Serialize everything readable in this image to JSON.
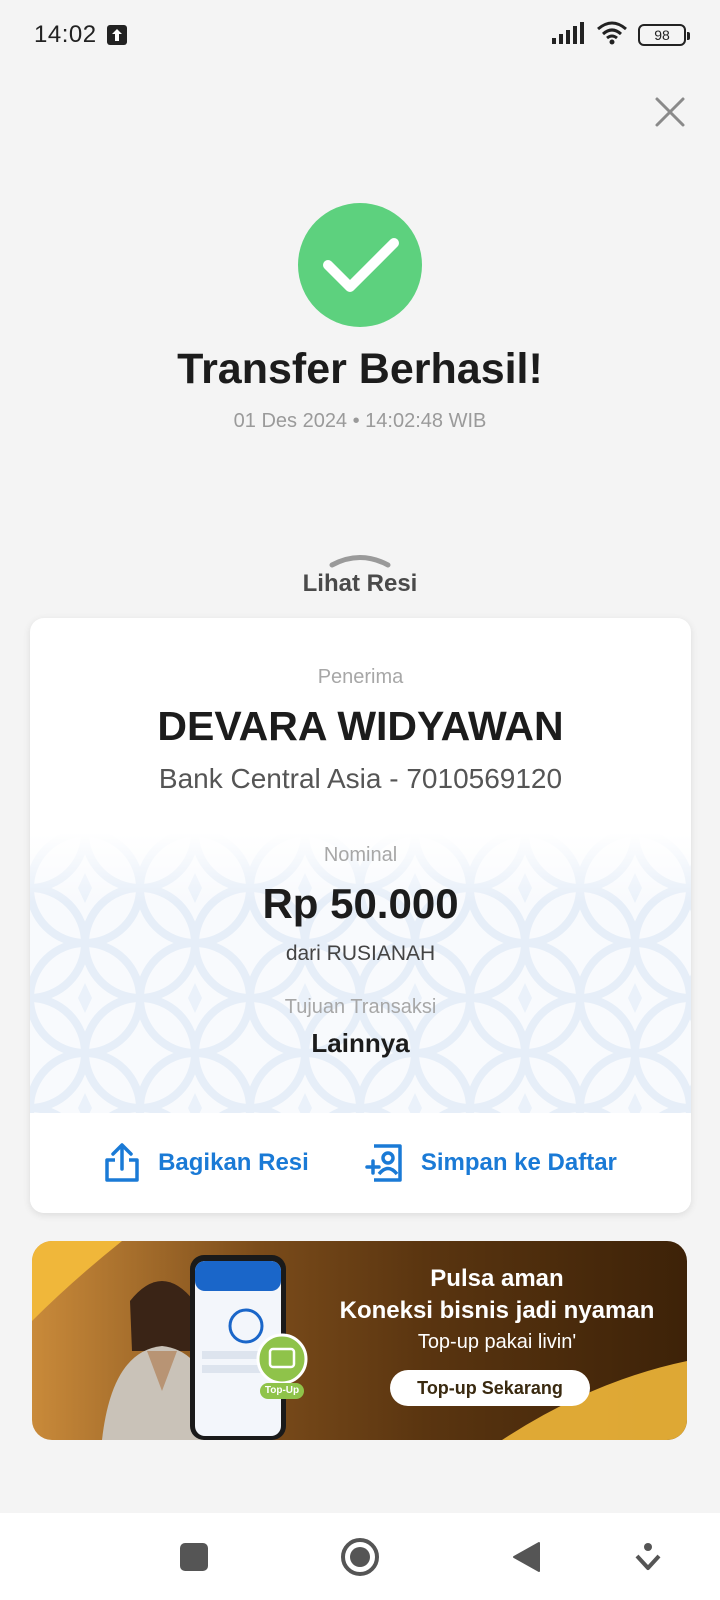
{
  "status_bar": {
    "time": "14:02",
    "battery": "98"
  },
  "result": {
    "title": "Transfer Berhasil!",
    "timestamp": "01 Des 2024 • 14:02:48 WIB"
  },
  "receipt_toggle": {
    "label": "Lihat Resi"
  },
  "receipt": {
    "recipient_label": "Penerima",
    "recipient_name": "DEVARA WIDYAWAN",
    "recipient_bank": "Bank Central Asia - 7010569120",
    "amount_label": "Nominal",
    "amount": "Rp 50.000",
    "from": "dari RUSIANAH",
    "purpose_label": "Tujuan Transaksi",
    "purpose": "Lainnya"
  },
  "actions": {
    "share_label": "Bagikan Resi",
    "save_label": "Simpan ke Daftar"
  },
  "banner": {
    "line1": "Pulsa aman",
    "line2": "Koneksi bisnis jadi nyaman",
    "line3": "Top-up pakai livin'",
    "cta": "Top-up Sekarang",
    "badge": "Top-Up"
  },
  "colors": {
    "success_green": "#5dd17e",
    "action_blue": "#1a7ad6",
    "background": "#f4f4f4"
  },
  "icons": {
    "close": "close-icon",
    "check": "checkmark-icon",
    "share": "share-icon",
    "save_contact": "add-contact-icon"
  }
}
